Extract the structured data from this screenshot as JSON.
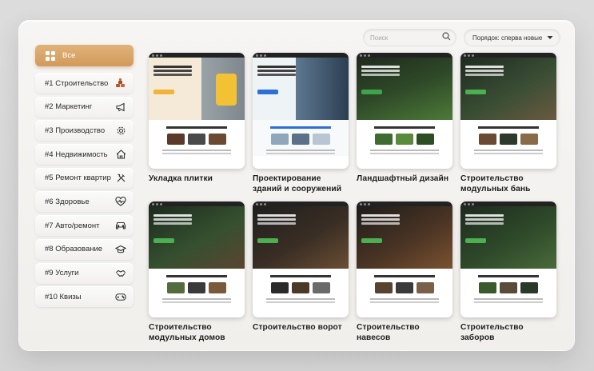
{
  "sidebar": {
    "items": [
      {
        "label": "Все",
        "icon": "grid-icon"
      },
      {
        "label": "#1 Строительство",
        "icon": "brick-pile-icon"
      },
      {
        "label": "#2 Маркетинг",
        "icon": "megaphone-icon"
      },
      {
        "label": "#3 Производство",
        "icon": "gear-icon"
      },
      {
        "label": "#4 Недвижимость",
        "icon": "house-icon"
      },
      {
        "label": "#5 Ремонт квартир",
        "icon": "tools-icon"
      },
      {
        "label": "#6 Здоровье",
        "icon": "heart-pulse-icon"
      },
      {
        "label": "#7 Авто/ремонт",
        "icon": "car-icon"
      },
      {
        "label": "#8 Образование",
        "icon": "graduation-cap-icon"
      },
      {
        "label": "#9 Услуги",
        "icon": "handshake-icon"
      },
      {
        "label": "#10 Квизы",
        "icon": "gamepad-icon"
      }
    ]
  },
  "search": {
    "placeholder": "Поиск"
  },
  "sort": {
    "value": "Порядок: сперва новые"
  },
  "colors": {
    "accent": "#d9a56a",
    "text": "#1d1d1d"
  },
  "cards": [
    {
      "title": "Укладка плитки"
    },
    {
      "title": "Проектирование зданий и сооружений"
    },
    {
      "title": "Ландшафтный дизайн"
    },
    {
      "title": "Строительство модульных бань"
    },
    {
      "title": "Строительство модульных домов"
    },
    {
      "title": "Строительство ворот"
    },
    {
      "title": "Строительство навесов"
    },
    {
      "title": "Строительство заборов"
    }
  ]
}
